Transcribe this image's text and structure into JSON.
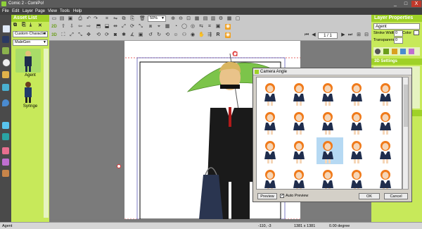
{
  "titlebar": {
    "title": "Comic 2 - ComiPo!",
    "minimize": "_",
    "maximize": "□",
    "close": "X"
  },
  "menu": [
    "File",
    "Edit",
    "Layer",
    "Page",
    "View",
    "Tools",
    "Help"
  ],
  "asset_list": {
    "title": "Asset List",
    "category": "Custom Character",
    "filter": "MaleGen",
    "items": [
      "Agent",
      "Syringe"
    ]
  },
  "toolbar": {
    "zoom": "50%",
    "page_indicator": "1 / 1",
    "row_labels": [
      "2D",
      "3D"
    ]
  },
  "layer_properties": {
    "title": "Layer Properties",
    "name_value": "Agent",
    "stroke_width_label": "Stroke Width",
    "stroke_width_value": "0",
    "color_label": "Color",
    "transparency_label": "Transparency",
    "transparency_value": "0",
    "settings_tab": "3D Settings"
  },
  "dialog": {
    "title": "Camera Angle",
    "preview_button": "Preview",
    "auto_preview_label": "Auto Preview",
    "auto_preview_checked": true,
    "ok_button": "OK",
    "cancel_button": "Cancel"
  },
  "status": {
    "left": "Agent",
    "coords": "-110, -3",
    "size": "1381 x 1381",
    "angle": "0.00 degree"
  },
  "colors": {
    "accent_green": "#9fd127",
    "panel_green": "#c7e95a",
    "umbrella": "#7cc44a",
    "hair": "#f07a1a"
  }
}
